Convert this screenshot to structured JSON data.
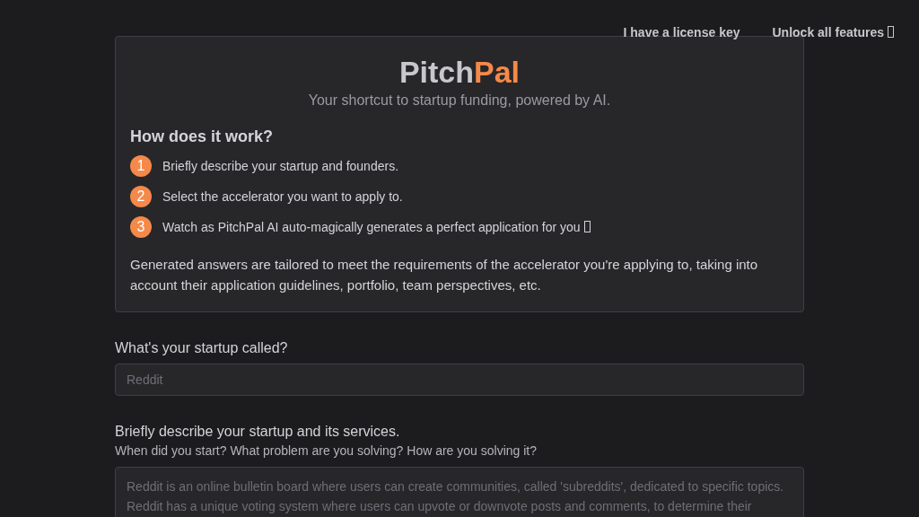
{
  "top_links": [
    {
      "label": "I have a license key",
      "icon": false
    },
    {
      "label": "Unlock all features",
      "icon": true
    }
  ],
  "intro": {
    "brand": "Pitch",
    "brand_accent": "Pal",
    "tagline": "Your shortcut to startup funding, powered by AI.",
    "heading": "How does it work?",
    "steps": [
      {
        "number": "1",
        "text": "Briefly describe your startup and founders.",
        "icon": false
      },
      {
        "number": "2",
        "text": "Select the accelerator you want to apply to.",
        "icon": false
      },
      {
        "number": "3",
        "text": "Watch as PitchPal AI auto-magically generates a perfect application for you",
        "icon": true
      }
    ],
    "note": "Generated answers are tailored to meet the requirements of the accelerator you're applying to, taking into account their application guidelines, portfolio, team perspectives, etc."
  },
  "form": [
    {
      "kind": "input",
      "label": "What's your startup called?",
      "placeholder": "Reddit"
    },
    {
      "kind": "textarea",
      "label": "Briefly describe your startup and its services.",
      "hint": "When did you start? What problem are you solving? How are you solving it?",
      "placeholder": "Reddit is an online bulletin board where users can create communities, called 'subreddits', dedicated to specific topics. Reddit has a unique voting system where users can upvote or downvote posts and comments, to determine their"
    }
  ]
}
